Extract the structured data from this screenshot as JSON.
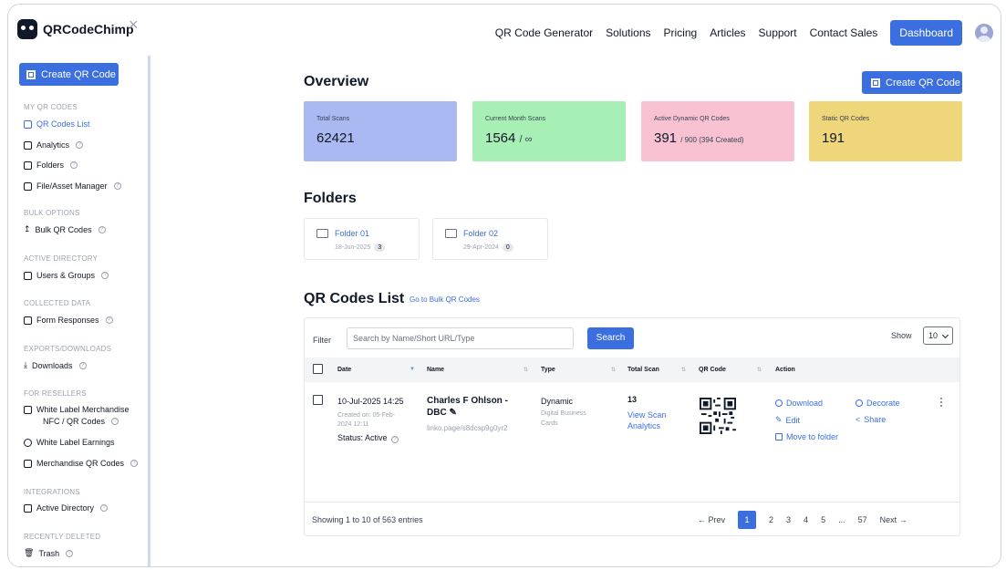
{
  "brand": {
    "name": "QRCodeChimp"
  },
  "nav": {
    "items": [
      "QR Code Generator",
      "Solutions",
      "Pricing",
      "Articles",
      "Support",
      "Contact Sales"
    ],
    "dashboard": "Dashboard"
  },
  "sidebar": {
    "create": "Create QR Code",
    "sections": [
      {
        "title": "MY QR CODES"
      },
      {
        "title": "BULK OPTIONS"
      },
      {
        "title": "ACTIVE DIRECTORY"
      },
      {
        "title": "COLLECTED DATA"
      },
      {
        "title": "EXPORTS/DOWNLOADS"
      },
      {
        "title": "FOR RESELLERS"
      },
      {
        "title": "INTEGRATIONS"
      },
      {
        "title": "RECENTLY DELETED"
      }
    ],
    "items": [
      {
        "label": "QR Codes List",
        "help": false
      },
      {
        "label": "Analytics",
        "help": true
      },
      {
        "label": "Folders",
        "help": true
      },
      {
        "label": "File/Asset Manager",
        "help": true
      },
      {
        "label": "Bulk QR Codes",
        "help": true
      },
      {
        "label": "Users & Groups",
        "help": true
      },
      {
        "label": "Form Responses",
        "help": true
      },
      {
        "label": "Downloads",
        "help": true
      },
      {
        "label": "White Label Merchandise",
        "help": false
      },
      {
        "label": "NFC / QR Codes",
        "help": true
      },
      {
        "label": "White Label Earnings",
        "help": false
      },
      {
        "label": "Merchandise QR Codes",
        "help": true
      },
      {
        "label": "Active Directory",
        "help": true
      },
      {
        "label": "Trash",
        "help": true
      }
    ]
  },
  "overview": {
    "title": "Overview",
    "create": "Create QR Code",
    "cards": [
      {
        "label": "Total Scans",
        "value": "62421",
        "sub": "",
        "color": "#aab9f2"
      },
      {
        "label": "Current Month Scans",
        "value": "1564",
        "sub": "/ ∞",
        "color": "#a7efb4"
      },
      {
        "label": "Active Dynamic QR Codes",
        "value": "391",
        "sub": "/ 900 (394 Created)",
        "color": "#f9c2d2"
      },
      {
        "label": "Static QR Codes",
        "value": "191",
        "sub": "",
        "color": "#efd67b"
      }
    ]
  },
  "folders": {
    "title": "Folders",
    "items": [
      {
        "name": "Folder 01",
        "date": "18-Jun-2025",
        "count": "3"
      },
      {
        "name": "Folder 02",
        "date": "29-Apr-2024",
        "count": "0"
      }
    ]
  },
  "qr_list": {
    "title": "QR Codes List",
    "bulk_link": "Go to Bulk QR Codes",
    "filter_label": "Filter",
    "search_placeholder": "Search by Name/Short URL/Type",
    "search_button": "Search",
    "show_label": "Show",
    "show_value": "10",
    "columns": [
      "Date",
      "Name",
      "Type",
      "Total Scan",
      "QR Code",
      "Action"
    ],
    "rows": [
      {
        "date": "10-Jul-2025 14:25",
        "created": "Created on: 05-Feb-",
        "created2": "2024 12:11",
        "status": "Status: Active",
        "name": "Charles F Ohlson -",
        "name2": "DBC",
        "url": "linko.page/s8dcsp9g0yr2",
        "type": "Dynamic",
        "type_sub1": "Digital Business",
        "type_sub2": "Cards",
        "scans": "13",
        "view_analytics": "View Scan",
        "view_analytics2": "Analytics",
        "actions": {
          "download": "Download",
          "decorate": "Decorate",
          "edit": "Edit",
          "share": "Share",
          "move": "Move to folder"
        }
      }
    ],
    "footer": {
      "showing": "Showing 1 to 10 of 563 entries",
      "prev": "← Prev",
      "pages": [
        "1",
        "2",
        "3",
        "4",
        "5",
        "...",
        "57"
      ],
      "next": "Next →"
    }
  }
}
